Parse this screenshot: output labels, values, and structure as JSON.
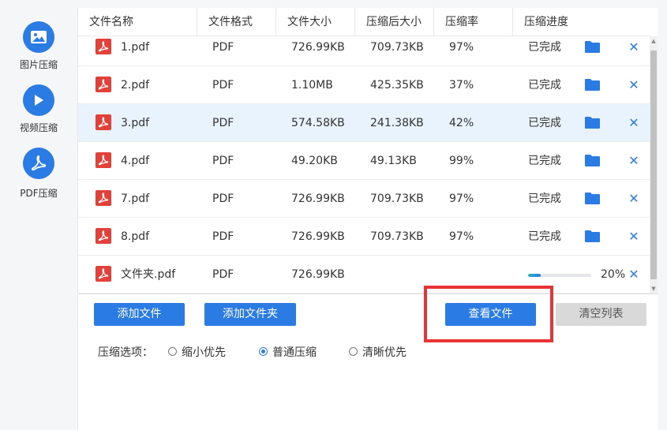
{
  "sidebar": {
    "items": [
      {
        "label": "图片压缩",
        "icon": "image-icon"
      },
      {
        "label": "视频压缩",
        "icon": "play-icon"
      },
      {
        "label": "PDF压缩",
        "icon": "pdf-icon"
      }
    ]
  },
  "table": {
    "headers": [
      "文件名称",
      "文件格式",
      "文件大小",
      "压缩后大小",
      "压缩率",
      "压缩进度"
    ],
    "rows": [
      {
        "name": "1.pdf",
        "format": "PDF",
        "size": "726.99KB",
        "compressed": "709.73KB",
        "rate": "97%",
        "status": "已完成"
      },
      {
        "name": "2.pdf",
        "format": "PDF",
        "size": "1.10MB",
        "compressed": "425.35KB",
        "rate": "37%",
        "status": "已完成"
      },
      {
        "name": "3.pdf",
        "format": "PDF",
        "size": "574.58KB",
        "compressed": "241.38KB",
        "rate": "42%",
        "status": "已完成"
      },
      {
        "name": "4.pdf",
        "format": "PDF",
        "size": "49.20KB",
        "compressed": "49.13KB",
        "rate": "99%",
        "status": "已完成"
      },
      {
        "name": "7.pdf",
        "format": "PDF",
        "size": "726.99KB",
        "compressed": "709.73KB",
        "rate": "97%",
        "status": "已完成"
      },
      {
        "name": "8.pdf",
        "format": "PDF",
        "size": "726.99KB",
        "compressed": "709.73KB",
        "rate": "97%",
        "status": "已完成"
      },
      {
        "name": "文件夹.pdf",
        "format": "PDF",
        "size": "726.99KB",
        "compressed": "",
        "rate": "",
        "status": "",
        "progress_percent": 20,
        "progress_label": "20%"
      }
    ],
    "selected_row": 2
  },
  "buttons": {
    "add_file": "添加文件",
    "add_folder": "添加文件夹",
    "view_files": "查看文件",
    "clear_list": "清空列表"
  },
  "options": {
    "title": "压缩选项：",
    "items": [
      {
        "label": "缩小优先",
        "checked": false
      },
      {
        "label": "普通压缩",
        "checked": true
      },
      {
        "label": "清晰优先",
        "checked": false
      }
    ]
  },
  "colors": {
    "accent": "#2b7be4",
    "pdf_red": "#e2413a",
    "highlight_red": "#e83434",
    "selected_row": "#e9f3fd"
  },
  "icons": {
    "close": "✕"
  }
}
